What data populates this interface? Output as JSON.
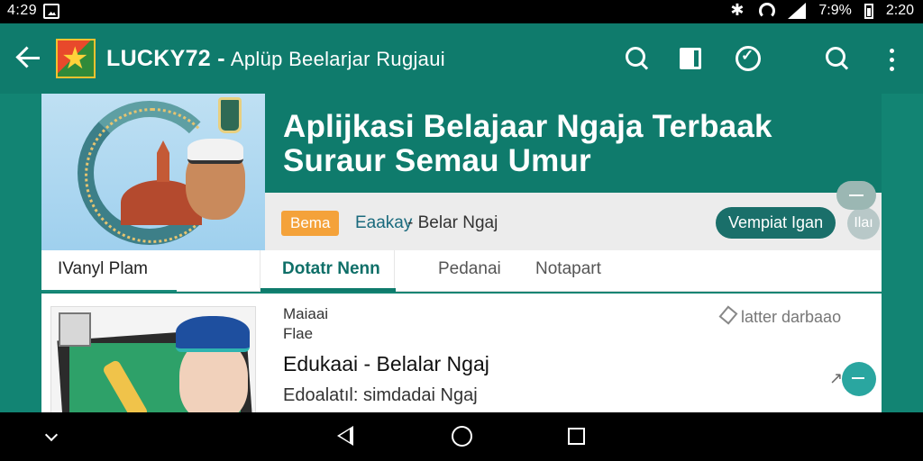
{
  "status_bar": {
    "time": "4:29",
    "battery_percent": "7:9%",
    "right_time": "2:20"
  },
  "app_bar": {
    "title": "LUCKY72 -",
    "subtitle": "Aplüp Beelarjar Rugjaui"
  },
  "hero": {
    "title_line1": "Aplijkasi Belajaar Ngaja Terbaak",
    "title_line2": "Suraur Semau Umur",
    "tag": "Bema",
    "link": "Eaakay",
    "meta_text": "Belar Ngaj",
    "cta_label": "Vempiat Igan",
    "cta_extra": "Ilaı"
  },
  "tabs": [
    {
      "label": "IVanyl Plam"
    },
    {
      "label": "Dotatr Nenn"
    },
    {
      "label": "Pedanai"
    },
    {
      "label": "Notapart"
    }
  ],
  "card": {
    "kicker": "Maiaai",
    "kicker2": "Flae",
    "title": "Edukaai - Belalar Ngaj",
    "desc": "Edoalatıl: simdadai Ngaj",
    "save_label": "latter darbaao"
  },
  "colors": {
    "primary": "#0f7b6c",
    "accent": "#f4a23a",
    "cta": "#1a6f6a"
  }
}
